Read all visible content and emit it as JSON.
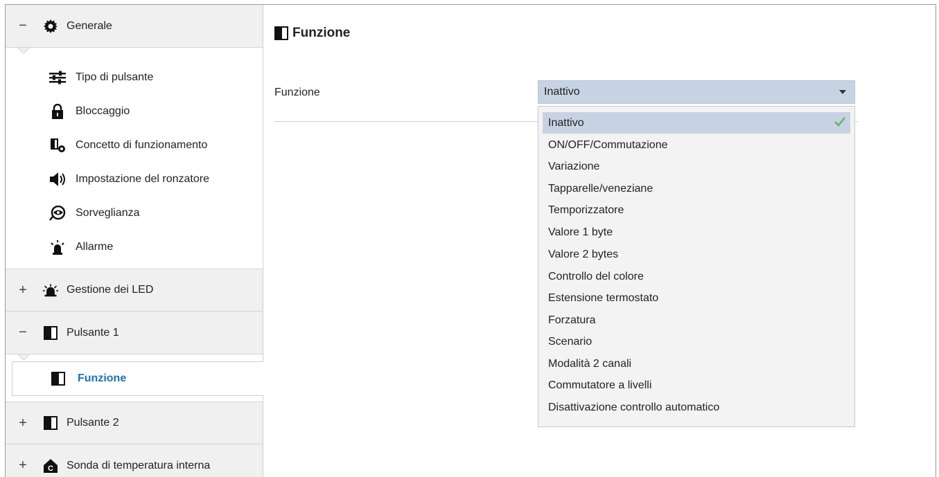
{
  "sidebar": {
    "generale": {
      "toggle": "−",
      "label": "Generale",
      "icon": "gear-icon"
    },
    "generale_items": [
      {
        "label": "Tipo di pulsante",
        "icon": "sliders-icon"
      },
      {
        "label": "Bloccaggio",
        "icon": "lock-icon"
      },
      {
        "label": "Concetto di funzionamento",
        "icon": "panel-gear-icon"
      },
      {
        "label": "Impostazione del ronzatore",
        "icon": "speaker-icon"
      },
      {
        "label": "Sorveglianza",
        "icon": "eye-icon"
      },
      {
        "label": "Allarme",
        "icon": "alarm-icon"
      }
    ],
    "led": {
      "toggle": "+",
      "label": "Gestione dei LED",
      "icon": "led-icon"
    },
    "pulsante1": {
      "toggle": "−",
      "label": "Pulsante 1",
      "icon": "half-square-icon"
    },
    "pulsante1_items": [
      {
        "label": "Funzione",
        "icon": "half-square-icon"
      }
    ],
    "pulsante2": {
      "toggle": "+",
      "label": "Pulsante 2",
      "icon": "half-square-icon"
    },
    "sonda": {
      "toggle": "+",
      "label": "Sonda di temperatura interna",
      "icon": "thermo-house-icon"
    }
  },
  "main": {
    "title": "Funzione",
    "field_label": "Funzione",
    "select_value": "Inattivo",
    "options": [
      "Inattivo",
      "ON/OFF/Commutazione",
      "Variazione",
      "Tapparelle/veneziane",
      "Temporizzatore",
      "Valore 1 byte",
      "Valore 2 bytes",
      "Controllo del colore",
      "Estensione termostato",
      "Forzatura",
      "Scenario",
      "Modalità 2 canali",
      "Commutatore a livelli",
      "Disattivazione controllo automatico"
    ],
    "selected_option": "Inattivo"
  },
  "colors": {
    "accent": "#1a73b8",
    "selection_bg": "#c7d3e3",
    "check": "#5cb85c",
    "group_bg": "#f0f0f0"
  }
}
